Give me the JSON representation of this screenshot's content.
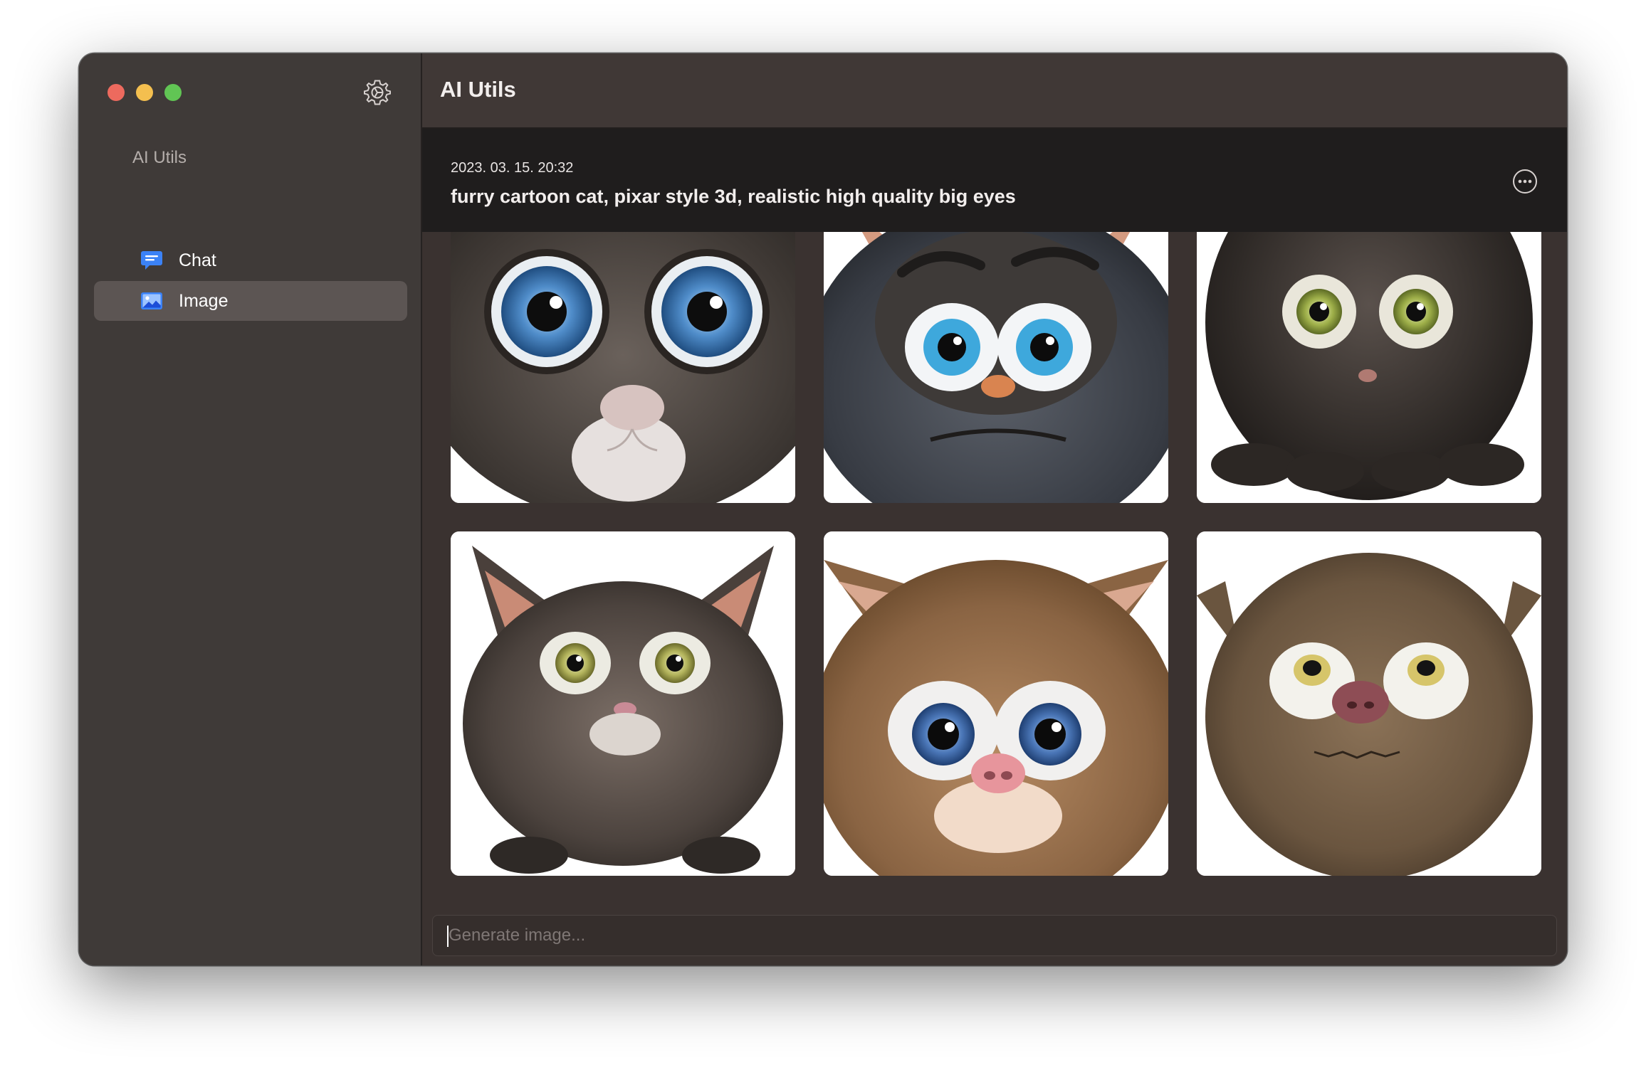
{
  "sidebar": {
    "section_title": "AI Utils",
    "items": [
      {
        "label": "Chat",
        "icon": "chat-bubble-icon",
        "selected": false
      },
      {
        "label": "Image",
        "icon": "photo-icon",
        "selected": true
      }
    ]
  },
  "header": {
    "title": "AI Utils"
  },
  "prompt": {
    "timestamp": "2023. 03. 15. 20:32",
    "text": "furry cartoon cat, pixar style 3d, realistic high quality big eyes"
  },
  "gallery": {
    "image_count": 6
  },
  "input": {
    "placeholder": "Generate image...",
    "value": ""
  },
  "colors": {
    "accent": "#3b82f6",
    "traffic_red": "#ed6a5e",
    "traffic_yellow": "#f4bf4f",
    "traffic_green": "#61c554"
  }
}
